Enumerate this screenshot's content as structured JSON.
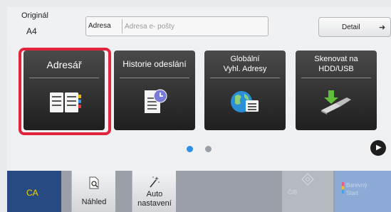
{
  "original": {
    "label": "Originál",
    "value": "A4"
  },
  "address": {
    "label": "Adresa",
    "placeholder": "Adresa e- pošty"
  },
  "detail_label": "Detail",
  "tiles": [
    {
      "label": "Adresář",
      "icon": "address-book-icon",
      "selected": true
    },
    {
      "label": "Historie odeslání",
      "icon": "send-history-icon",
      "selected": false
    },
    {
      "label_lines": [
        "Globální",
        "Vyhl. Adresy"
      ],
      "icon": "global-address-search-icon",
      "selected": false
    },
    {
      "label_lines": [
        "Skenovat na",
        "HDD/USB"
      ],
      "icon": "scan-to-hdd-usb-icon",
      "selected": false
    }
  ],
  "pager": {
    "pages": 2,
    "active": 1
  },
  "bottom": {
    "ca_label": "CA",
    "preview_label": "Náhled",
    "auto_label_lines": [
      "Auto",
      "nastavení"
    ],
    "bw_start_label": "Č/B",
    "color_start_label_lines": [
      "Barevný",
      "Start"
    ]
  },
  "colors": {
    "selection": "#e2233d",
    "ca_background": "#284a82",
    "ca_text": "#f5d500",
    "color_start": "#8daad6",
    "pager_active": "#2f8fe6"
  }
}
